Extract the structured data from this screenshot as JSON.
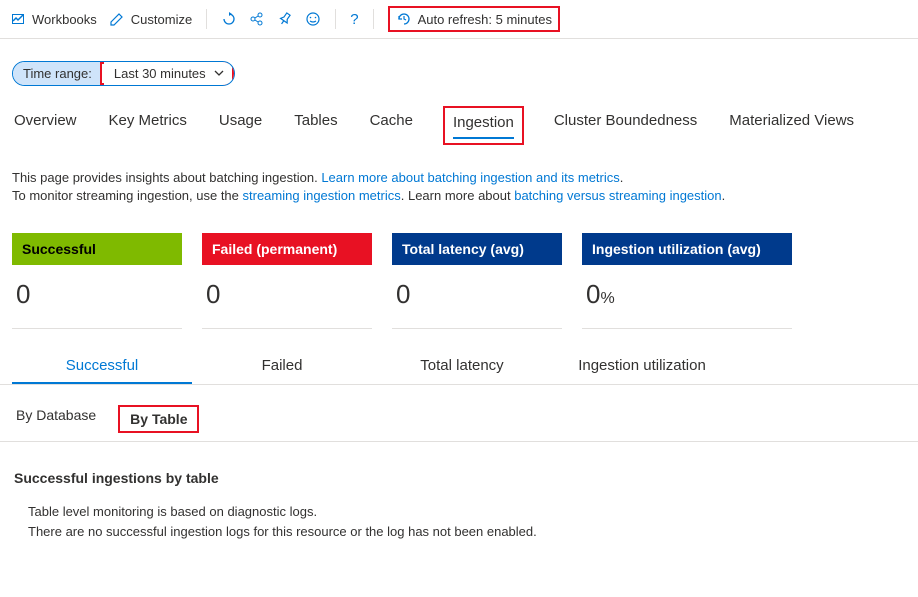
{
  "toolbar": {
    "workbooks": "Workbooks",
    "customize": "Customize",
    "autoRefresh": "Auto refresh: 5 minutes",
    "helpLabel": "?"
  },
  "timeRange": {
    "label": "Time range:",
    "value": "Last 30 minutes"
  },
  "tabs": {
    "overview": "Overview",
    "keyMetrics": "Key Metrics",
    "usage": "Usage",
    "tables": "Tables",
    "cache": "Cache",
    "ingestion": "Ingestion",
    "clusterBoundedness": "Cluster Boundedness",
    "materializedViews": "Materialized Views"
  },
  "desc": {
    "line1a": "This page provides insights about batching ingestion. ",
    "link1": "Learn more about batching ingestion and its metrics",
    "line2a": "To monitor streaming ingestion, use the ",
    "link2": "streaming ingestion metrics",
    "line2b": ". Learn more about ",
    "link3": "batching versus streaming ingestion",
    "period": "."
  },
  "cards": {
    "successful": {
      "title": "Successful",
      "value": "0"
    },
    "failed": {
      "title": "Failed (permanent)",
      "value": "0"
    },
    "latency": {
      "title": "Total latency (avg)",
      "value": "0"
    },
    "utilization": {
      "title": "Ingestion utilization (avg)",
      "value": "0",
      "unit": "%"
    }
  },
  "subTabs": {
    "successful": "Successful",
    "failed": "Failed",
    "totalLatency": "Total latency",
    "ingestionUtil": "Ingestion utilization"
  },
  "groupTabs": {
    "byDatabase": "By Database",
    "byTable": "By Table"
  },
  "section": {
    "title": "Successful ingestions by table",
    "body1": "Table level monitoring is based on diagnostic logs.",
    "body2": "There are no successful ingestion logs for this resource or the log has not been enabled."
  }
}
